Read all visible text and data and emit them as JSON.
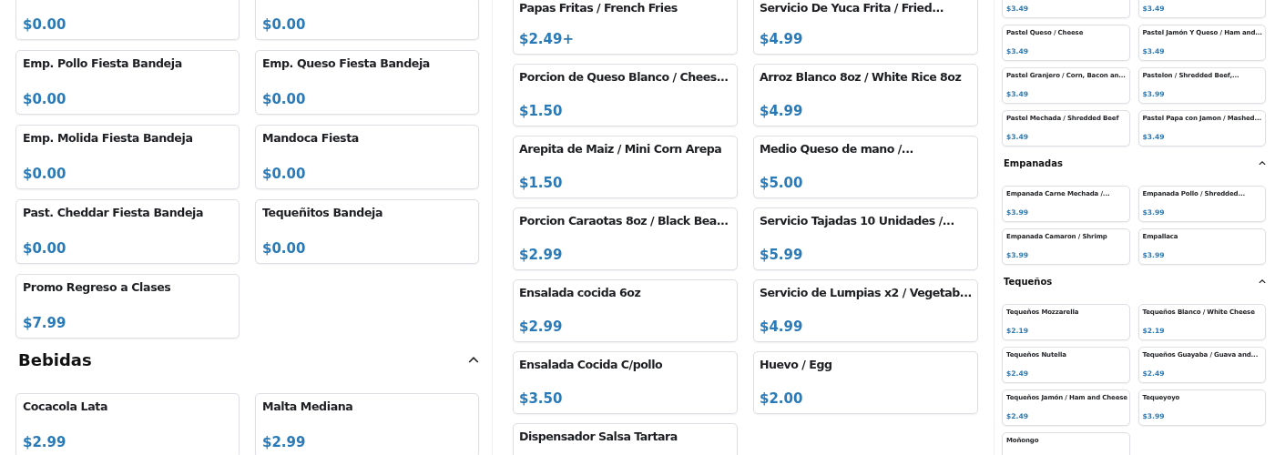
{
  "panels": [
    {
      "blocks": [
        {
          "kind": "items",
          "items": [
            {
              "price": "$0.00"
            },
            {
              "price": "$0.00"
            }
          ]
        },
        {
          "kind": "items",
          "items": [
            {
              "name": "Emp. Pollo Fiesta Bandeja",
              "price": "$0.00"
            },
            {
              "name": "Emp. Queso Fiesta Bandeja",
              "price": "$0.00"
            }
          ]
        },
        {
          "kind": "items",
          "items": [
            {
              "name": "Emp. Molida Fiesta Bandeja",
              "price": "$0.00"
            },
            {
              "name": "Mandoca Fiesta",
              "price": "$0.00"
            }
          ]
        },
        {
          "kind": "items",
          "items": [
            {
              "name": "Past. Cheddar Fiesta Bandeja",
              "price": "$0.00"
            },
            {
              "name": "Tequeñitos Bandeja",
              "price": "$0.00"
            }
          ]
        },
        {
          "kind": "items",
          "items": [
            {
              "name": "Promo Regreso a Clases",
              "price": "$7.99"
            }
          ]
        },
        {
          "kind": "section",
          "title": "Bebidas",
          "expanded": true
        },
        {
          "kind": "items",
          "items": [
            {
              "name": "Cocacola Lata",
              "price": "$2.99"
            },
            {
              "name": "Malta Mediana",
              "price": "$2.99"
            }
          ]
        }
      ]
    },
    {
      "blocks": [
        {
          "kind": "items",
          "items": [
            {
              "name": "Papas Fritas / French Fries",
              "price": "$2.49+"
            },
            {
              "name": "Servicio De Yuca Frita / Fried...",
              "price": "$4.99"
            }
          ]
        },
        {
          "kind": "items",
          "items": [
            {
              "name": "Porcion de Queso Blanco / Chees...",
              "price": "$1.50"
            },
            {
              "name": "Arroz Blanco 8oz / White Rice 8oz",
              "price": "$4.99"
            }
          ]
        },
        {
          "kind": "items",
          "items": [
            {
              "name": "Arepita de Maiz / Mini Corn Arepa",
              "price": "$1.50"
            },
            {
              "name": "Medio Queso de mano /...",
              "price": "$5.00"
            }
          ]
        },
        {
          "kind": "items",
          "items": [
            {
              "name": "Porcion Caraotas 8oz / Black Bea...",
              "price": "$2.99"
            },
            {
              "name": "Servicio Tajadas 10 Unidades /...",
              "price": "$5.99"
            }
          ]
        },
        {
          "kind": "items",
          "items": [
            {
              "name": "Ensalada cocida 6oz",
              "price": "$2.99"
            },
            {
              "name": "Servicio de Lumpias x2 / Vegetab...",
              "price": "$4.99"
            }
          ]
        },
        {
          "kind": "items",
          "items": [
            {
              "name": "Ensalada Cocida C/pollo",
              "price": "$3.50"
            },
            {
              "name": "Huevo / Egg",
              "price": "$2.00"
            }
          ]
        },
        {
          "kind": "items",
          "items": [
            {
              "name": "Dispensador Salsa Tartara"
            }
          ]
        }
      ]
    },
    {
      "blocks": [
        {
          "kind": "items",
          "items": [
            {
              "price": "$3.49"
            },
            {
              "price": "$3.49"
            }
          ]
        },
        {
          "kind": "items",
          "items": [
            {
              "name": "Pastel Queso / Cheese",
              "price": "$3.49"
            },
            {
              "name": "Pastel Jamón Y Queso / Ham and...",
              "price": "$3.49"
            }
          ]
        },
        {
          "kind": "items",
          "items": [
            {
              "name": "Pastel Granjero / Corn, Bacon an...",
              "price": "$3.49"
            },
            {
              "name": "Pastelon / Shredded Beef,...",
              "price": "$3.99"
            }
          ]
        },
        {
          "kind": "items",
          "items": [
            {
              "name": "Pastel Mechada / Shredded Beef",
              "price": "$3.49"
            },
            {
              "name": "Pastel Papa con Jamon / Mashed...",
              "price": "$3.49"
            }
          ]
        },
        {
          "kind": "section",
          "title": "Empanadas",
          "expanded": true
        },
        {
          "kind": "items",
          "items": [
            {
              "name": "Empanada Carne Mechada /...",
              "price": "$3.99"
            },
            {
              "name": "Empanada Pollo / Shredded...",
              "price": "$3.99"
            }
          ]
        },
        {
          "kind": "items",
          "items": [
            {
              "name": "Empanada Camaron / Shrimp",
              "price": "$3.99"
            },
            {
              "name": "Empallaca",
              "price": "$3.99"
            }
          ]
        },
        {
          "kind": "section",
          "title": "Tequeños",
          "expanded": true
        },
        {
          "kind": "items",
          "items": [
            {
              "name": "Tequeños Mozzarella",
              "price": "$2.19"
            },
            {
              "name": "Tequeños Blanco / White Cheese",
              "price": "$2.19"
            }
          ]
        },
        {
          "kind": "items",
          "items": [
            {
              "name": "Tequeños Nutella",
              "price": "$2.49"
            },
            {
              "name": "Tequeños Guayaba / Guava and...",
              "price": "$2.49"
            }
          ]
        },
        {
          "kind": "items",
          "items": [
            {
              "name": "Tequeños Jamón / Ham and Cheese",
              "price": "$2.49"
            },
            {
              "name": "Tequeyoyo",
              "price": "$3.99"
            }
          ]
        },
        {
          "kind": "items",
          "items": [
            {
              "name": "Moñongo"
            }
          ]
        }
      ]
    }
  ]
}
